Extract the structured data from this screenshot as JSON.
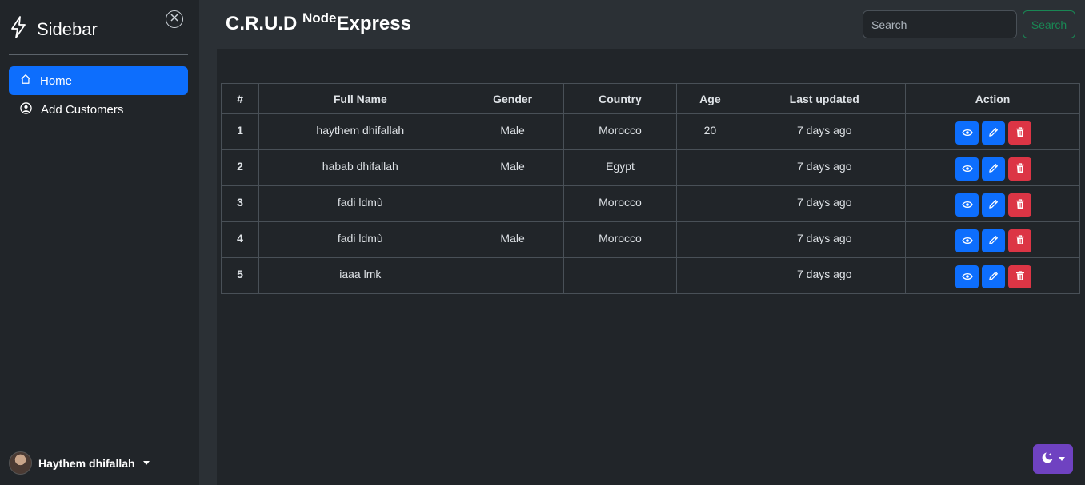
{
  "sidebar": {
    "title": "Sidebar",
    "items": [
      {
        "label": "Home",
        "icon": "home-icon",
        "active": true
      },
      {
        "label": "Add Customers",
        "icon": "user-circle-icon",
        "active": false
      }
    ],
    "user": {
      "name": "Haythem dhifallah"
    }
  },
  "header": {
    "title_main": "C.R.U.D",
    "title_sup": "Node",
    "title_tail": "Express",
    "search_placeholder": "Search",
    "search_button": "Search"
  },
  "table": {
    "headers": [
      "#",
      "Full Name",
      "Gender",
      "Country",
      "Age",
      "Last updated",
      "Action"
    ],
    "rows": [
      {
        "num": "1",
        "name": "haythem dhifallah",
        "gender": "Male",
        "country": "Morocco",
        "age": "20",
        "updated": "7 days ago"
      },
      {
        "num": "2",
        "name": "habab dhifallah",
        "gender": "Male",
        "country": "Egypt",
        "age": "",
        "updated": "7 days ago"
      },
      {
        "num": "3",
        "name": "fadi ldmù",
        "gender": "",
        "country": "Morocco",
        "age": "",
        "updated": "7 days ago"
      },
      {
        "num": "4",
        "name": "fadi ldmù",
        "gender": "Male",
        "country": "Morocco",
        "age": "",
        "updated": "7 days ago"
      },
      {
        "num": "5",
        "name": "iaaa lmk",
        "gender": "",
        "country": "",
        "age": "",
        "updated": "7 days ago"
      }
    ]
  },
  "colors": {
    "primary": "#0d6efd",
    "danger": "#dc3545",
    "success": "#198754",
    "theme_toggle": "#6f42c1",
    "background": "#212529"
  },
  "icons": {
    "brand": "lightning-icon",
    "close": "close-circle-icon",
    "view": "eye-icon",
    "edit": "pencil-icon",
    "delete": "trash-icon",
    "theme": "moon-stars-icon"
  }
}
